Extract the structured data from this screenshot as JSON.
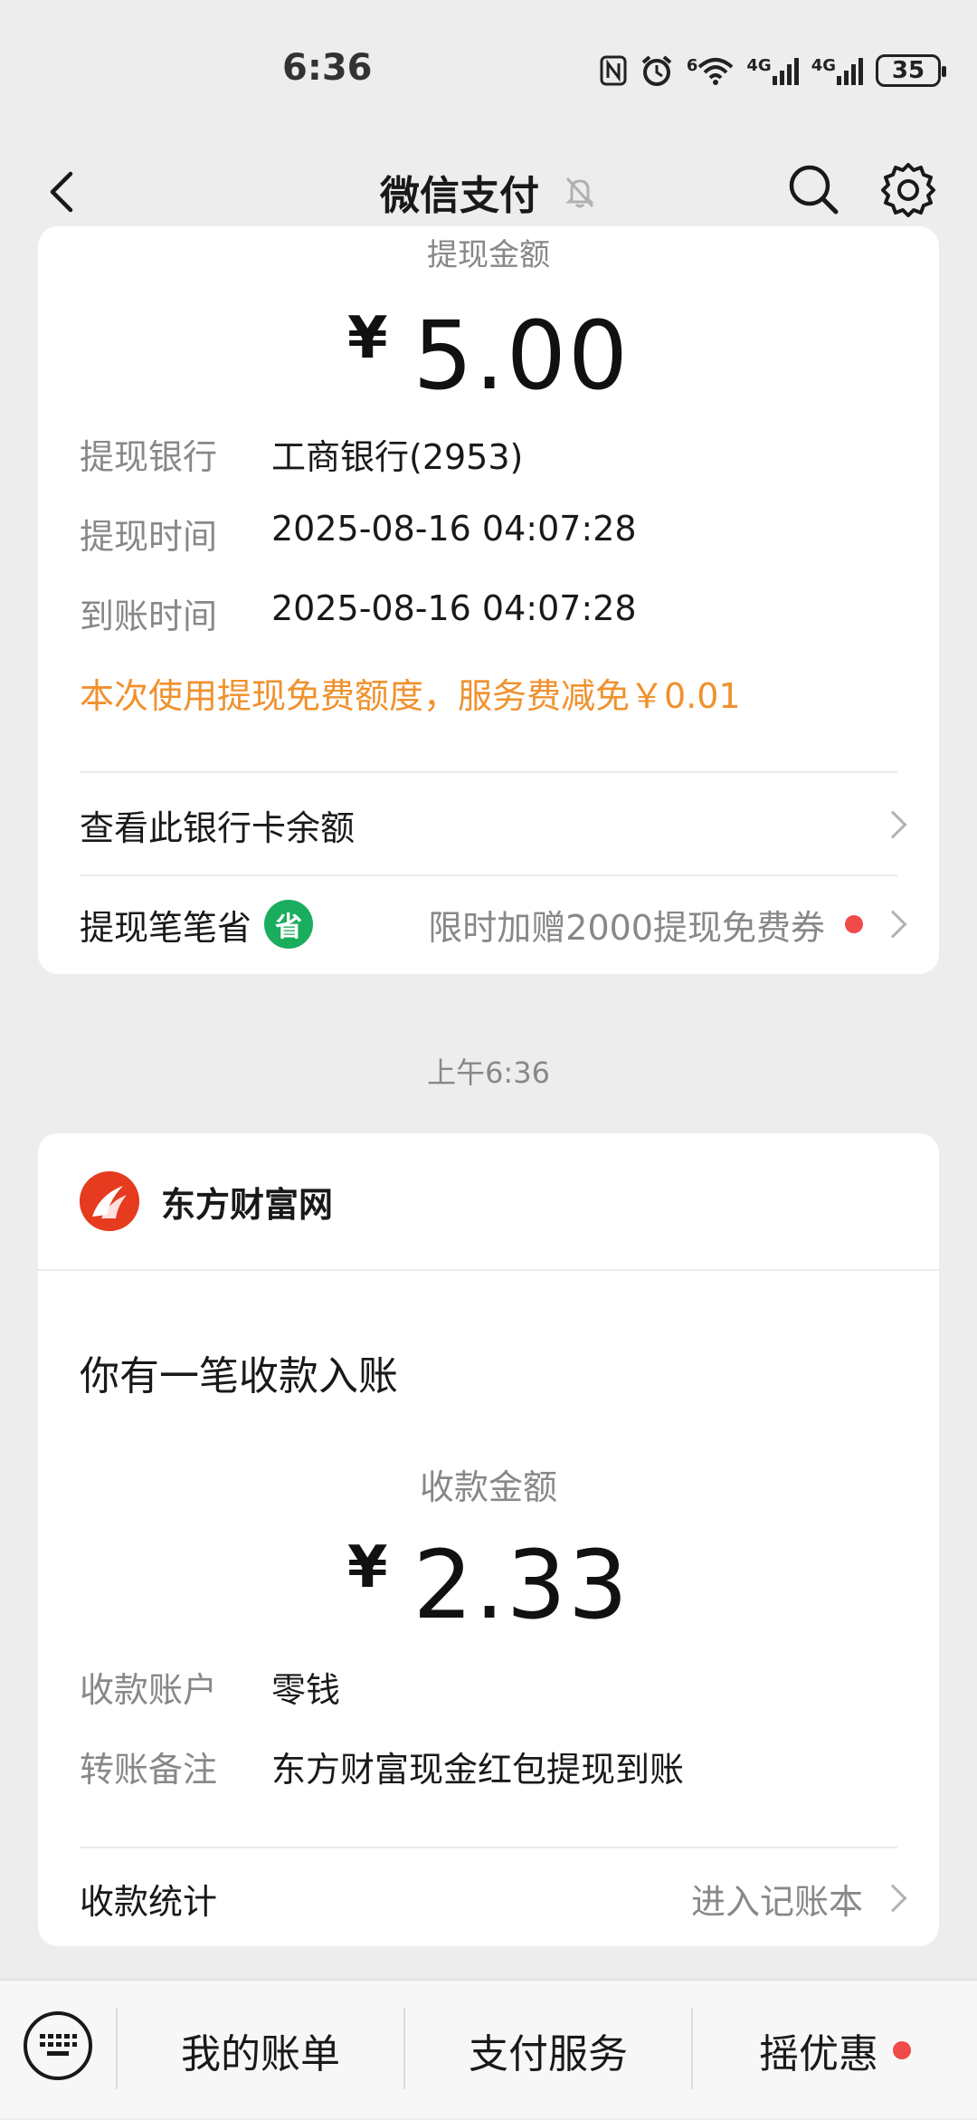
{
  "status_bar": {
    "time": "6:36",
    "signal_labels": [
      "6",
      "4G",
      "4G"
    ],
    "battery": "35"
  },
  "nav": {
    "title": "微信支付",
    "back_icon": "back-arrow-icon",
    "mute_icon": "bell-mute-icon",
    "search_icon": "search-icon",
    "settings_icon": "gear-icon"
  },
  "withdrawal_card": {
    "amount_label": "提现金额",
    "currency": "¥",
    "amount": "5.00",
    "details": [
      {
        "key": "提现银行",
        "value": "工商银行(2953)"
      },
      {
        "key": "提现时间",
        "value": "2025-08-16 04:07:28"
      },
      {
        "key": "到账时间",
        "value": "2025-08-16 04:07:28"
      }
    ],
    "fee_note": "本次使用提现免费额度，服务费减免￥0.01",
    "check_balance_label": "查看此银行卡余额",
    "save_label": "提现笔笔省",
    "save_badge": "省",
    "save_promo": "限时加赠2000提现免费券"
  },
  "timestamp": "上午6:36",
  "receipt_card": {
    "merchant": "东方财富网",
    "headline": "你有一笔收款入账",
    "amount_label": "收款金额",
    "currency": "¥",
    "amount": "2.33",
    "details": [
      {
        "key": "收款账户",
        "value": "零钱"
      },
      {
        "key": "转账备注",
        "value": "东方财富现金红包提现到账"
      }
    ],
    "stats_label": "收款统计",
    "stats_link": "进入记账本"
  },
  "bottom_bar": {
    "tabs": [
      "我的账单",
      "支付服务",
      "摇优惠"
    ]
  },
  "colors": {
    "background": "#ededed",
    "orange": "#f0912d",
    "green_badge": "#1aad5d",
    "red_dot": "#f04a4a",
    "merchant_logo": "#e63b1f"
  }
}
